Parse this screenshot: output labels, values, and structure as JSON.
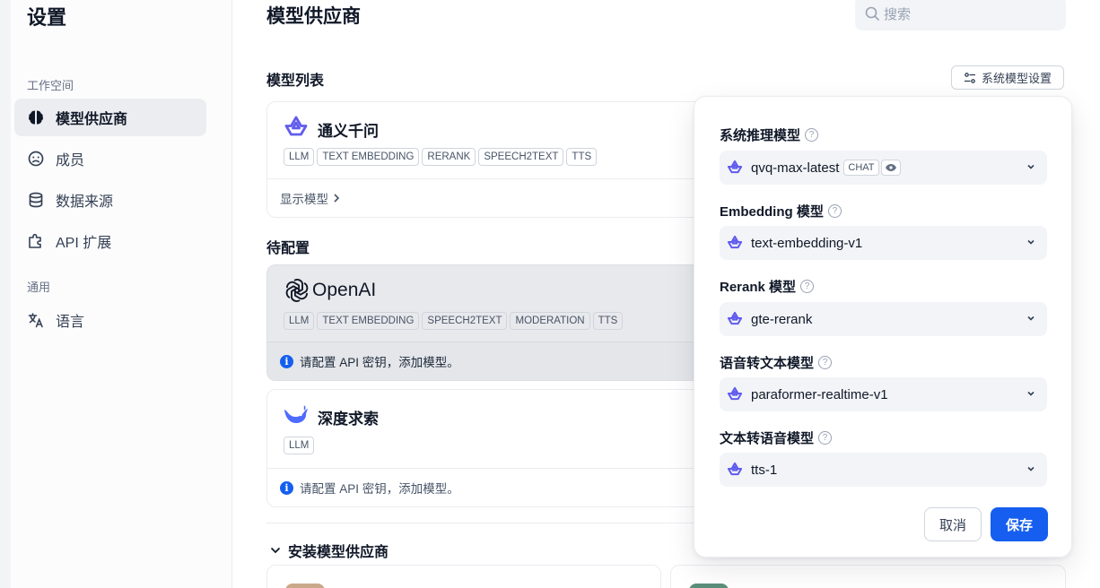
{
  "sidebar": {
    "title": "设置",
    "sections": [
      "工作空间",
      "通用"
    ],
    "items": [
      {
        "label": "模型供应商",
        "icon": "brain-icon",
        "active": true
      },
      {
        "label": "成员",
        "icon": "members-icon"
      },
      {
        "label": "数据来源",
        "icon": "database-icon"
      },
      {
        "label": "API 扩展",
        "icon": "puzzle-icon"
      },
      {
        "label": "语言",
        "icon": "translate-icon"
      }
    ]
  },
  "header": {
    "title": "模型供应商",
    "search_placeholder": "搜索"
  },
  "model_list": {
    "title": "模型列表",
    "system_settings_button": "系统模型设置"
  },
  "providers": [
    {
      "name": "通义千问",
      "tags": [
        "LLM",
        "TEXT EMBEDDING",
        "RERANK",
        "SPEECH2TEXT",
        "TTS"
      ],
      "footer": "显示模型"
    },
    {
      "name": "OpenAI",
      "tags": [
        "LLM",
        "TEXT EMBEDDING",
        "SPEECH2TEXT",
        "MODERATION",
        "TTS"
      ],
      "footer": "请配置 API 密钥，添加模型。"
    },
    {
      "name": "深度求索",
      "tags": [
        "LLM"
      ],
      "footer": "请配置 API 密钥，添加模型。"
    }
  ],
  "pending_title": "待配置",
  "install_title": "安装模型供应商",
  "popover": {
    "fields": [
      {
        "label": "系统推理模型",
        "value": "qvq-max-latest",
        "tag": "CHAT"
      },
      {
        "label": "Embedding 模型",
        "value": "text-embedding-v1"
      },
      {
        "label": "Rerank 模型",
        "value": "gte-rerank"
      },
      {
        "label": "语音转文本模型",
        "value": "paraformer-realtime-v1"
      },
      {
        "label": "文本转语音模型",
        "value": "tts-1"
      }
    ],
    "cancel": "取消",
    "save": "保存"
  },
  "colors": {
    "accent": "#155eef",
    "tongyi": "#615ced",
    "deepseek": "#4d6bfe"
  }
}
